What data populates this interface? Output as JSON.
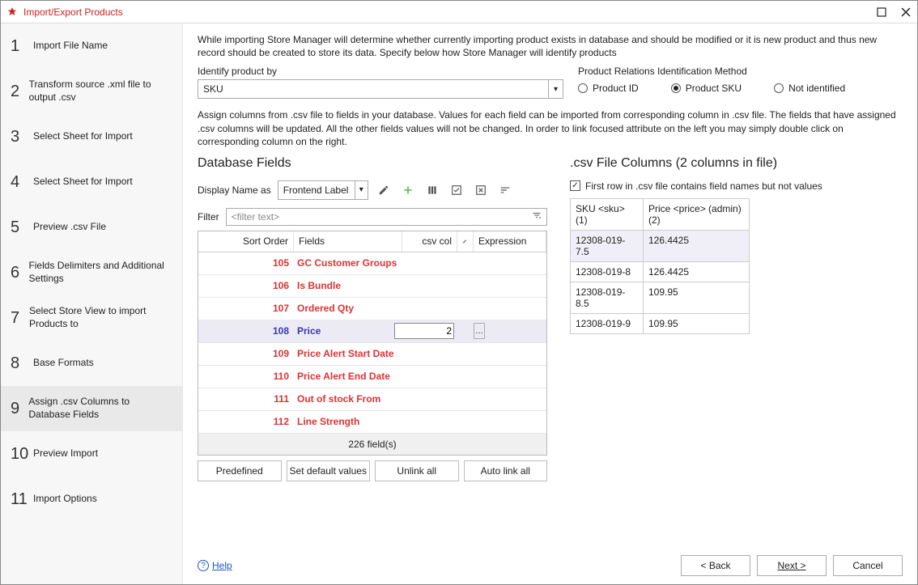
{
  "window": {
    "title": "Import/Export Products"
  },
  "sidebar": {
    "steps": [
      {
        "num": "1",
        "label": "Import File Name"
      },
      {
        "num": "2",
        "label": "Transform source .xml file to output .csv"
      },
      {
        "num": "3",
        "label": "Select Sheet for Import"
      },
      {
        "num": "4",
        "label": "Select Sheet for Import"
      },
      {
        "num": "5",
        "label": "Preview .csv File"
      },
      {
        "num": "6",
        "label": "Fields Delimiters and Additional Settings"
      },
      {
        "num": "7",
        "label": "Select Store View to import Products to"
      },
      {
        "num": "8",
        "label": "Base Formats"
      },
      {
        "num": "9",
        "label": "Assign .csv Columns to Database Fields"
      },
      {
        "num": "10",
        "label": "Preview Import"
      },
      {
        "num": "11",
        "label": "Import Options"
      }
    ],
    "active_index": 8
  },
  "main": {
    "intro": "While importing Store Manager will determine whether currently importing product exists in database and should be modified or it is new product and thus new record should be created to store its data. Specify below how Store Manager will identify products",
    "identify_label": "Identify product by",
    "identify_value": "SKU",
    "relation_label": "Product Relations Identification Method",
    "radios": {
      "product_id": "Product ID",
      "product_sku": "Product SKU",
      "not_identified": "Not identified",
      "selected": "product_sku"
    },
    "assign_text": "Assign columns from .csv file to fields in your database. Values for each field can be imported from corresponding column in .csv file. The fields that have assigned .csv columns will be updated. All the other fields values will not be changed. In order to link focused attribute on the left you may simply double click on corresponding column on the right.",
    "db_fields_title": "Database Fields",
    "display_name_label": "Display Name as",
    "display_name_value": "Frontend Label",
    "filter_label": "Filter",
    "filter_placeholder": "<filter text>",
    "grid": {
      "cols": {
        "sort": "Sort Order",
        "field": "Fields",
        "csv": "csv col",
        "expr": "Expression"
      },
      "rows": [
        {
          "sort": "105",
          "field": "GC Customer Groups",
          "csv": "",
          "sel": false
        },
        {
          "sort": "106",
          "field": "Is Bundle",
          "csv": "",
          "sel": false
        },
        {
          "sort": "107",
          "field": "Ordered Qty",
          "csv": "",
          "sel": false
        },
        {
          "sort": "108",
          "field": "Price",
          "csv": "2",
          "sel": true
        },
        {
          "sort": "109",
          "field": "Price Alert Start Date",
          "csv": "",
          "sel": false
        },
        {
          "sort": "110",
          "field": "Price Alert End Date",
          "csv": "",
          "sel": false
        },
        {
          "sort": "111",
          "field": "Out of stock From",
          "csv": "",
          "sel": false
        },
        {
          "sort": "112",
          "field": "Line Strength",
          "csv": "",
          "sel": false
        }
      ],
      "footer": "226 field(s)"
    },
    "buttons": {
      "predefined": "Predefined",
      "set_defaults": "Set default values",
      "unlink": "Unlink all",
      "autolink": "Auto link all"
    },
    "csv_title": ".csv File Columns (2 columns in file)",
    "chk_label": "First row in .csv file contains field names but not values",
    "csv_table": {
      "head": {
        "c1": "SKU <sku> (1)",
        "c2": "Price <price> (admin) (2)"
      },
      "rows": [
        {
          "c1": "12308-019-7.5",
          "c2": "126.4425",
          "sel": true
        },
        {
          "c1": "12308-019-8",
          "c2": "126.4425",
          "sel": false
        },
        {
          "c1": "12308-019-8.5",
          "c2": "109.95",
          "sel": false
        },
        {
          "c1": "12308-019-9",
          "c2": "109.95",
          "sel": false
        }
      ]
    }
  },
  "footer": {
    "help": "Help",
    "back": "< Back",
    "next": "Next >",
    "cancel": "Cancel"
  }
}
